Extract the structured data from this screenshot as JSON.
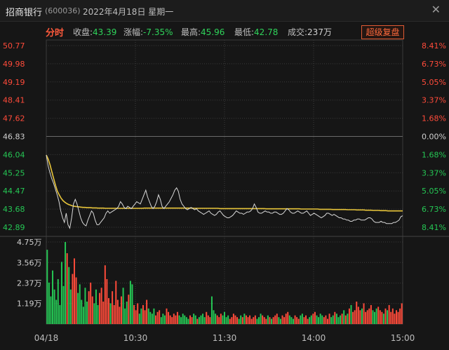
{
  "header": {
    "name": "招商银行",
    "code": "(600036)",
    "date": "2022年4月18日",
    "weekday": "星期一",
    "close_icon": "close-icon"
  },
  "infobar": {
    "tab": "分时",
    "close_label": "收盘:",
    "close_value": "43.39",
    "change_label": "涨幅:",
    "change_value": "-7.35%",
    "high_label": "最高:",
    "high_value": "45.96",
    "low_label": "最低:",
    "low_value": "42.78",
    "volume_label": "成交:",
    "volume_value": "237万",
    "restore_button": "超级复盘"
  },
  "colors": {
    "up": "#ff4b3a",
    "down": "#25c754",
    "neutral": "#d0d0d0",
    "avg": "#e8c53a",
    "price": "#d8d8d8",
    "grid": "#3a3a3a"
  },
  "chart_data": {
    "type": "line",
    "price_axis": {
      "left_ticks": [
        "50.77",
        "49.98",
        "49.19",
        "48.41",
        "47.62",
        "46.83",
        "46.04",
        "45.25",
        "44.47",
        "43.68",
        "42.89"
      ],
      "right_ticks": [
        "8.41%",
        "6.73%",
        "5.05%",
        "3.37%",
        "1.68%",
        "0.00%",
        "1.68%",
        "3.37%",
        "5.05%",
        "6.73%",
        "8.41%"
      ],
      "ylim": [
        42.89,
        50.77
      ],
      "prev_close": 46.83
    },
    "volume_axis": {
      "ticks": [
        "4.75万",
        "3.56万",
        "2.37万",
        "1.19万"
      ],
      "ylim": [
        0,
        4.75
      ]
    },
    "time_ticks": [
      "04/18",
      "10:30",
      "11:30",
      "14:00",
      "15:00"
    ],
    "series": [
      {
        "role": "price",
        "values": [
          46.02,
          45.55,
          45.25,
          45.0,
          44.8,
          44.55,
          44.3,
          44.0,
          43.6,
          43.3,
          43.1,
          43.5,
          43.0,
          42.85,
          43.3,
          43.9,
          44.1,
          43.9,
          43.6,
          43.3,
          43.1,
          43.0,
          42.95,
          43.2,
          43.4,
          43.6,
          43.5,
          43.2,
          43.0,
          43.0,
          43.1,
          43.2,
          43.3,
          43.5,
          43.6,
          43.5,
          43.55,
          43.6,
          43.65,
          43.7,
          43.8,
          44.0,
          43.9,
          43.75,
          43.7,
          43.8,
          43.75,
          43.7,
          43.8,
          43.9,
          44.0,
          43.95,
          43.9,
          44.1,
          44.3,
          44.5,
          44.2,
          44.0,
          43.8,
          43.7,
          43.8,
          44.0,
          44.3,
          44.1,
          43.8,
          43.7,
          43.8,
          43.9,
          44.0,
          44.15,
          44.3,
          44.5,
          44.6,
          44.45,
          44.1,
          43.9,
          43.8,
          43.7,
          43.65,
          43.7,
          43.75,
          43.7,
          43.65,
          43.7,
          43.6,
          43.55,
          43.5,
          43.45,
          43.5,
          43.55,
          43.6,
          43.5,
          43.45,
          43.4,
          43.45,
          43.55,
          43.6,
          43.5,
          43.4,
          43.35,
          43.3,
          43.3,
          43.35,
          43.4,
          43.5,
          43.6,
          43.55,
          43.5,
          43.5,
          43.45,
          43.5,
          43.55,
          43.55,
          43.6,
          43.7,
          43.9,
          43.75,
          43.55,
          43.5,
          43.5,
          43.55,
          43.6,
          43.55,
          43.55,
          43.5,
          43.5,
          43.55,
          43.55,
          43.5,
          43.45,
          43.45,
          43.5,
          43.6,
          43.7,
          43.65,
          43.55,
          43.5,
          43.5,
          43.55,
          43.6,
          43.55,
          43.5,
          43.5,
          43.55,
          43.6,
          43.5,
          43.4,
          43.45,
          43.5,
          43.45,
          43.4,
          43.35,
          43.3,
          43.35,
          43.4,
          43.5,
          43.5,
          43.45,
          43.4,
          43.45,
          43.4,
          43.35,
          43.3,
          43.3,
          43.25,
          43.25,
          43.2,
          43.2,
          43.15,
          43.15,
          43.2,
          43.2,
          43.25,
          43.25,
          43.2,
          43.2,
          43.2,
          43.25,
          43.3,
          43.3,
          43.25,
          43.15,
          43.1,
          43.1,
          43.1,
          43.15,
          43.1,
          43.1,
          43.05,
          43.05,
          43.05,
          43.05,
          43.1,
          43.1,
          43.15,
          43.2,
          43.35,
          43.39
        ]
      },
      {
        "role": "average",
        "values": [
          46.02,
          45.85,
          45.6,
          45.3,
          45.0,
          44.7,
          44.45,
          44.3,
          44.15,
          44.05,
          43.98,
          43.92,
          43.88,
          43.85,
          43.82,
          43.8,
          43.79,
          43.78,
          43.77,
          43.76,
          43.75,
          43.75,
          43.74,
          43.74,
          43.74,
          43.73,
          43.73,
          43.73,
          43.72,
          43.72,
          43.72,
          43.72,
          43.71,
          43.71,
          43.71,
          43.71,
          43.71,
          43.71,
          43.71,
          43.71,
          43.71,
          43.71,
          43.71,
          43.71,
          43.71,
          43.71,
          43.71,
          43.71,
          43.71,
          43.71,
          43.71,
          43.71,
          43.71,
          43.72,
          43.72,
          43.72,
          43.72,
          43.72,
          43.72,
          43.72,
          43.72,
          43.72,
          43.72,
          43.72,
          43.72,
          43.72,
          43.72,
          43.72,
          43.72,
          43.72,
          43.72,
          43.72,
          43.72,
          43.72,
          43.72,
          43.72,
          43.72,
          43.72,
          43.72,
          43.72,
          43.71,
          43.71,
          43.71,
          43.71,
          43.71,
          43.71,
          43.71,
          43.71,
          43.71,
          43.71,
          43.71,
          43.71,
          43.71,
          43.71,
          43.7,
          43.7,
          43.7,
          43.7,
          43.7,
          43.7,
          43.7,
          43.7,
          43.7,
          43.7,
          43.7,
          43.7,
          43.7,
          43.7,
          43.7,
          43.7,
          43.7,
          43.7,
          43.7,
          43.7,
          43.7,
          43.7,
          43.7,
          43.7,
          43.7,
          43.69,
          43.69,
          43.69,
          43.69,
          43.69,
          43.69,
          43.69,
          43.69,
          43.69,
          43.69,
          43.69,
          43.69,
          43.69,
          43.69,
          43.69,
          43.69,
          43.69,
          43.69,
          43.69,
          43.68,
          43.68,
          43.68,
          43.68,
          43.68,
          43.68,
          43.68,
          43.68,
          43.68,
          43.68,
          43.67,
          43.67,
          43.67,
          43.67,
          43.67,
          43.67,
          43.67,
          43.66,
          43.66,
          43.66,
          43.66,
          43.66,
          43.66,
          43.66,
          43.66,
          43.65,
          43.65,
          43.65,
          43.65,
          43.65,
          43.64,
          43.64,
          43.64,
          43.64,
          43.64,
          43.63,
          43.63,
          43.63,
          43.63,
          43.62,
          43.62,
          43.62,
          43.62,
          43.61,
          43.61,
          43.61,
          43.61,
          43.6,
          43.6,
          43.6,
          43.6,
          43.6,
          43.6,
          43.6,
          43.6,
          43.6
        ]
      }
    ],
    "volume": {
      "values": [
        4.3,
        2.4,
        1.6,
        3.1,
        2.0,
        1.4,
        2.6,
        1.1,
        3.6,
        2.2,
        4.75,
        4.1,
        3.3,
        2.0,
        2.9,
        3.8,
        2.7,
        1.8,
        2.3,
        1.4,
        1.0,
        2.1,
        1.3,
        1.9,
        2.4,
        1.6,
        1.2,
        2.0,
        1.1,
        1.8,
        2.1,
        1.3,
        3.4,
        2.6,
        1.5,
        1.2,
        1.9,
        1.1,
        2.5,
        1.4,
        1.0,
        1.6,
        2.1,
        0.9,
        1.3,
        1.7,
        2.5,
        2.3,
        1.1,
        0.8,
        1.2,
        0.6,
        0.9,
        1.1,
        0.8,
        1.4,
        0.9,
        0.7,
        0.6,
        0.9,
        0.5,
        0.7,
        0.8,
        0.4,
        0.6,
        0.5,
        0.9,
        0.7,
        0.5,
        0.4,
        0.6,
        0.5,
        0.7,
        0.5,
        0.4,
        0.6,
        0.5,
        0.4,
        0.3,
        0.5,
        0.4,
        0.6,
        0.5,
        0.3,
        0.4,
        0.5,
        0.6,
        0.4,
        0.7,
        0.5,
        0.4,
        1.6,
        0.8,
        0.6,
        0.5,
        0.4,
        0.6,
        0.5,
        0.7,
        0.4,
        0.5,
        0.3,
        0.4,
        0.6,
        0.5,
        0.4,
        0.3,
        0.5,
        0.4,
        0.6,
        0.5,
        0.4,
        0.5,
        0.3,
        0.4,
        0.5,
        0.3,
        0.4,
        0.6,
        0.5,
        0.4,
        0.3,
        0.5,
        0.4,
        0.3,
        0.4,
        0.5,
        0.6,
        0.4,
        0.3,
        0.5,
        0.4,
        0.6,
        0.7,
        0.5,
        0.4,
        0.3,
        0.5,
        0.4,
        0.3,
        0.5,
        0.6,
        0.4,
        0.5,
        0.3,
        0.4,
        0.5,
        0.6,
        0.7,
        0.5,
        0.4,
        0.6,
        0.5,
        0.4,
        0.5,
        0.3,
        0.6,
        0.4,
        0.5,
        0.7,
        0.6,
        0.4,
        0.5,
        0.6,
        0.8,
        0.5,
        0.6,
        0.9,
        1.1,
        0.7,
        0.8,
        1.3,
        1.0,
        0.8,
        0.9,
        1.2,
        0.7,
        0.8,
        0.9,
        1.1,
        0.8,
        0.7,
        0.9,
        1.0,
        0.8,
        0.7,
        0.6,
        0.9,
        0.8,
        1.1,
        0.7,
        0.9,
        0.6,
        0.8,
        0.7,
        0.9,
        1.2
      ]
    }
  }
}
